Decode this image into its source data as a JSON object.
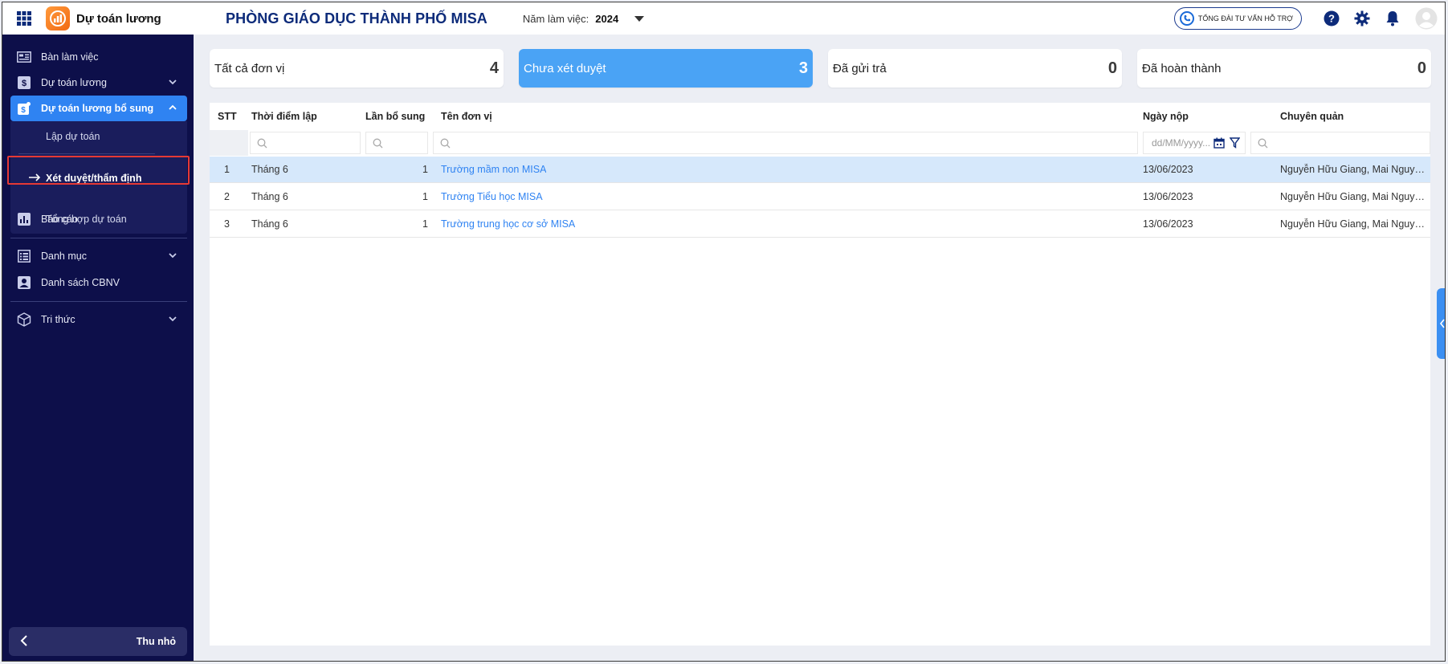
{
  "app": {
    "name": "Dự toán lương",
    "org": "PHÒNG GIÁO DỤC THÀNH PHỐ MISA",
    "year_label": "Năm làm việc:",
    "year": "2024"
  },
  "topbar": {
    "support": "TỔNG ĐÀI TƯ VẤN HỖ TRỢ"
  },
  "sidebar": {
    "items": [
      {
        "label": "Bàn làm việc"
      },
      {
        "label": "Dự toán lương"
      },
      {
        "label": "Dự toán lương bổ sung"
      },
      {
        "label": "Báo cáo"
      },
      {
        "label": "Danh mục"
      },
      {
        "label": "Danh sách CBNV"
      },
      {
        "label": "Tri thức"
      }
    ],
    "subitems": [
      {
        "label": "Lập dự toán"
      },
      {
        "label": "Xét duyệt/thẩm định"
      },
      {
        "label": "Tổng hợp dự toán"
      }
    ],
    "collapse": "Thu nhỏ"
  },
  "cards": [
    {
      "label": "Tất cả đơn vị",
      "count": "4"
    },
    {
      "label": "Chưa xét duyệt",
      "count": "3"
    },
    {
      "label": "Đã gửi trả",
      "count": "0"
    },
    {
      "label": "Đã hoàn thành",
      "count": "0"
    }
  ],
  "table": {
    "headers": {
      "stt": "STT",
      "time": "Thời điểm lập",
      "times": "Lần bổ sung",
      "unit": "Tên đơn vị",
      "date": "Ngày nộp",
      "manager": "Chuyên quản"
    },
    "date_placeholder": "dd/MM/yyyy...",
    "rows": [
      {
        "stt": "1",
        "time": "Tháng 6",
        "times": "1",
        "unit": "Trường mầm non MISA",
        "date": "13/06/2023",
        "manager": "Nguyễn Hữu Giang, Mai Nguyễ..."
      },
      {
        "stt": "2",
        "time": "Tháng 6",
        "times": "1",
        "unit": "Trường Tiểu học MISA",
        "date": "13/06/2023",
        "manager": "Nguyễn Hữu Giang, Mai Nguyễ..."
      },
      {
        "stt": "3",
        "time": "Tháng 6",
        "times": "1",
        "unit": "Trường trung học cơ sở MISA",
        "date": "13/06/2023",
        "manager": "Nguyễn Hữu Giang, Mai Nguyễ..."
      }
    ]
  }
}
